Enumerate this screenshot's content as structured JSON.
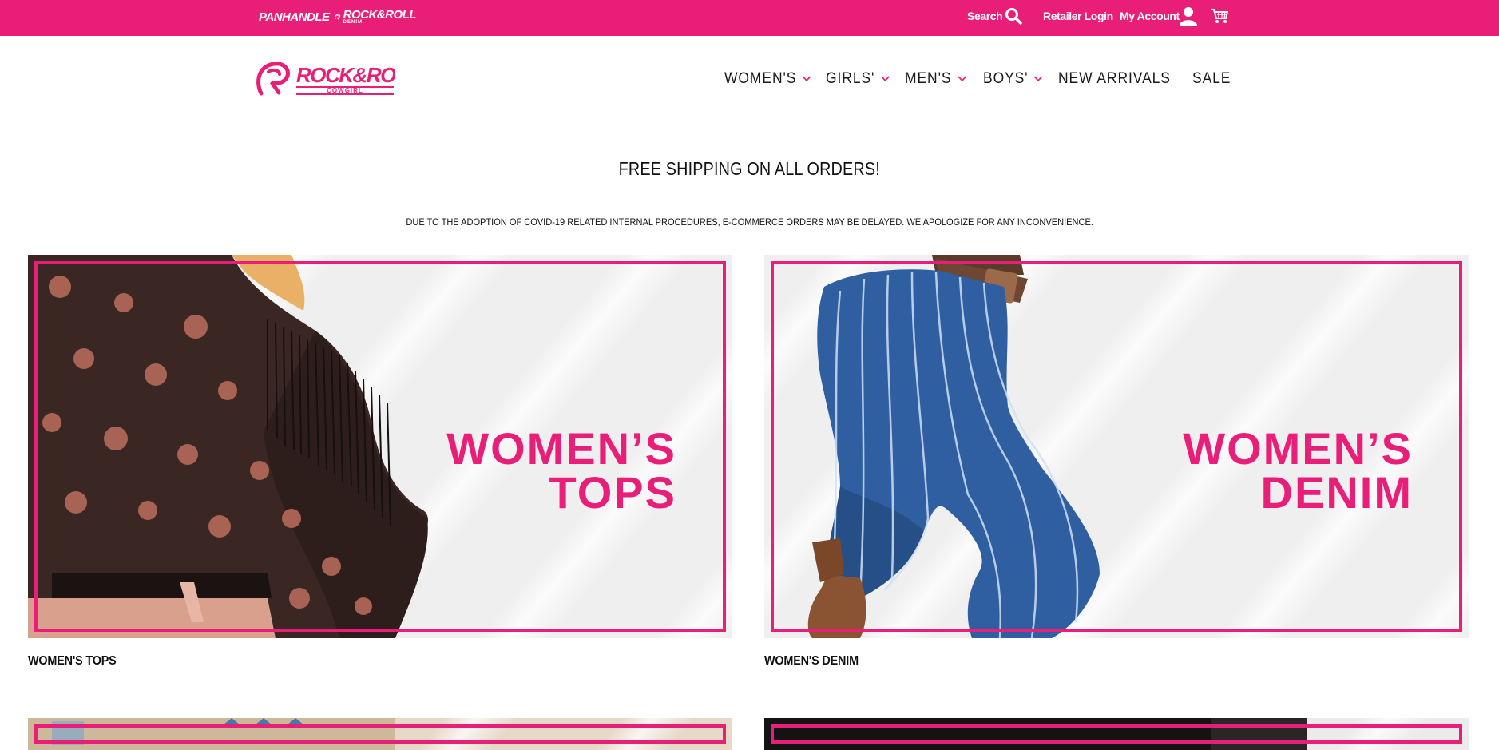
{
  "topbar": {
    "brands": [
      {
        "name": "PANHANDLE"
      },
      {
        "name": "ROCK&ROLL",
        "sub": "DENIM"
      }
    ],
    "search_label": "Search",
    "retailer_label": "Retailer Login",
    "account_label": "My Account",
    "icons": [
      "search-icon",
      "account-icon",
      "cart-icon"
    ]
  },
  "header": {
    "logo": {
      "main": "ROCK&ROLL",
      "sub": "COWGIRL"
    },
    "nav": [
      {
        "label": "WOMEN'S",
        "dropdown": true
      },
      {
        "label": "GIRLS'",
        "dropdown": true
      },
      {
        "label": "MEN'S",
        "dropdown": true
      },
      {
        "label": "BOYS'",
        "dropdown": true
      },
      {
        "label": "NEW ARRIVALS",
        "dropdown": false
      },
      {
        "label": "SALE",
        "dropdown": false
      }
    ]
  },
  "announcements": {
    "shipping": "FREE SHIPPING ON ALL ORDERS!",
    "covid": "DUE TO THE ADOPTION OF COVID-19 RELATED INTERNAL PROCEDURES, E-COMMERCE ORDERS MAY BE DELAYED. WE APOLOGIZE FOR ANY INCONVENIENCE."
  },
  "categories": [
    {
      "line1": "WOMEN’S",
      "line2": "TOPS",
      "caption": "WOMEN'S TOPS"
    },
    {
      "line1": "WOMEN’S",
      "line2": "DENIM",
      "caption": "WOMEN'S DENIM"
    }
  ],
  "colors": {
    "accent": "#e91e78",
    "text": "#111111",
    "tile_bg": "#efefef"
  }
}
